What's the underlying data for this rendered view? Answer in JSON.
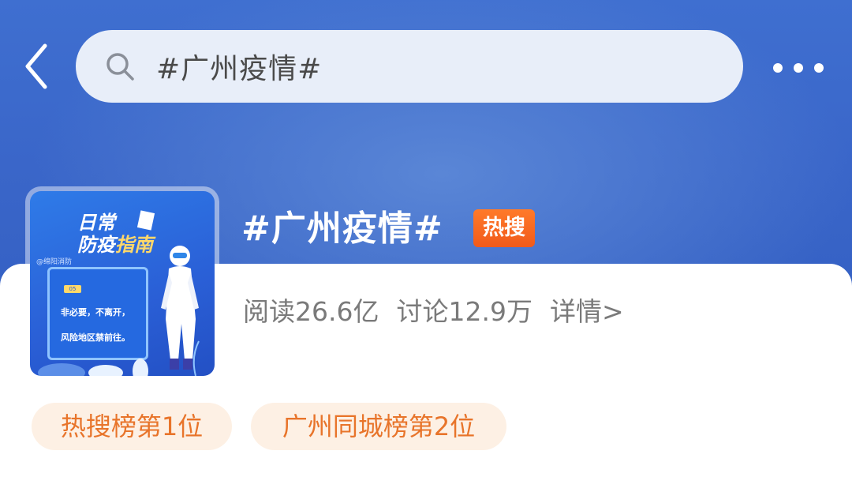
{
  "search": {
    "query": "#广州疫情#",
    "icons": {
      "back": "chevron-left-icon",
      "search": "search-icon",
      "more": "more-dots-icon"
    }
  },
  "topic": {
    "title": "#广州疫情#",
    "hot_badge": "热搜",
    "stats": {
      "read_label": "阅读26.6亿",
      "discuss_label": "讨论12.9万",
      "detail_label": "详情>"
    },
    "thumbnail": {
      "title_line1": "日常",
      "title_line2a": "防疫",
      "title_line2b": "指南",
      "tag": "@绵阳消防",
      "badge": "05",
      "line1": "非必要，不离开，",
      "line2": "风险地区禁前往。"
    },
    "rank_pills": [
      "热搜榜第1位",
      "广州同城榜第2位"
    ]
  },
  "colors": {
    "header_blue": "#3a66c9",
    "hot_badge": "#f15a1a",
    "pill_bg": "#fdf0e4",
    "pill_text": "#e8742a"
  }
}
